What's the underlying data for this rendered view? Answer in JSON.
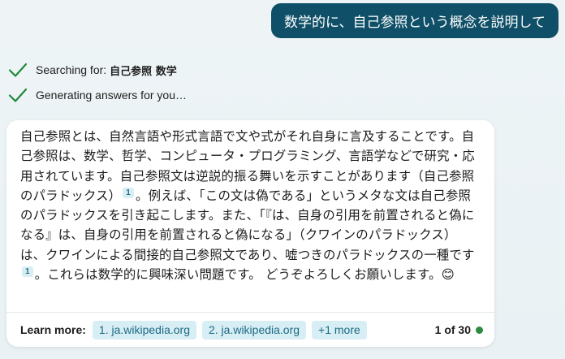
{
  "user_message": "数学的に、自己参照という概念を説明して",
  "status": [
    {
      "label": "Searching for:",
      "query": "自己参照 数学"
    },
    {
      "label": "Generating answers for you…",
      "query": ""
    }
  ],
  "answer": {
    "p1": "自己参照とは、自然言語や形式言語で文や式がそれ自身に言及することです。自己参照は、数学、哲学、コンピュータ・プログラミング、言語学などで研究・応用されています。自己参照文は逆説的振る舞いを示すことがあります（自己参照のパラドックス）",
    "cite1": "1",
    "p2": "。例えば、「この文は偽である」というメタな文は自己参照のパラドックスを引き起こします。また、「『は、自身の引用を前置されると偽になる』は、自身の引用を前置されると偽になる」（クワインのパラドックス）は、クワインによる間接的自己参照文であり、嘘つきのパラドックスの一種です",
    "cite2": "1",
    "p3": "。これらは数学的に興味深い問題です。 どうぞよろしくお願いします。😊"
  },
  "footer": {
    "learn_more_label": "Learn more:",
    "links": [
      "1. ja.wikipedia.org",
      "2. ja.wikipedia.org"
    ],
    "more_label": "+1 more",
    "pager": "1 of 30"
  },
  "colors": {
    "user_bubble": "#0f5068",
    "check": "#1e8a3a",
    "chip_bg": "#d6eef4",
    "status_dot": "#2e8a3e"
  },
  "icons": [
    "check-icon",
    "status-dot-icon"
  ]
}
